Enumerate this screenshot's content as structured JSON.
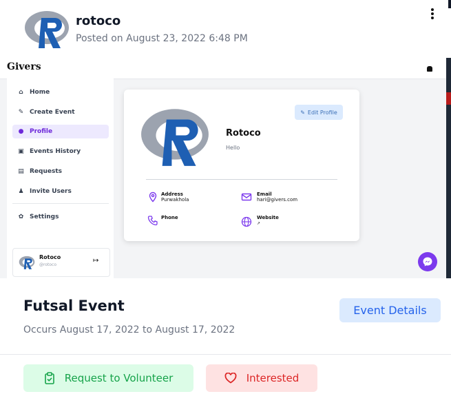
{
  "post": {
    "author": "rotoco",
    "posted": "Posted on August 23, 2022 6:48 PM"
  },
  "screenshot": {
    "brand": "Givers",
    "nav": [
      {
        "label": "Home",
        "icon": "home-icon"
      },
      {
        "label": "Create Event",
        "icon": "edit-icon"
      },
      {
        "label": "Profile",
        "icon": "user-icon",
        "active": true
      },
      {
        "label": "Events History",
        "icon": "clipboard-icon"
      },
      {
        "label": "Requests",
        "icon": "inbox-icon"
      },
      {
        "label": "Invite Users",
        "icon": "user-plus-icon"
      },
      {
        "label": "Settings",
        "icon": "gear-icon"
      }
    ],
    "user_card": {
      "name": "Rotoco",
      "handle": "@rotoco"
    },
    "profile": {
      "name": "Rotoco",
      "bio": "Hello",
      "edit_label": "Edit Profile",
      "address_label": "Address",
      "address_value": "Purwakhola",
      "email_label": "Email",
      "email_value": "hari@givers.com",
      "phone_label": "Phone",
      "website_label": "Website"
    }
  },
  "event": {
    "title": "Futsal Event",
    "dates": "Occurs August 17, 2022 to August 17, 2022",
    "details_label": "Event Details",
    "volunteer_label": "Request to Volunteer",
    "interested_label": "Interested"
  },
  "colors": {
    "accent_purple": "#7c3aed",
    "blue": "#2563eb",
    "green": "#16a34a",
    "red": "#dc2626"
  }
}
